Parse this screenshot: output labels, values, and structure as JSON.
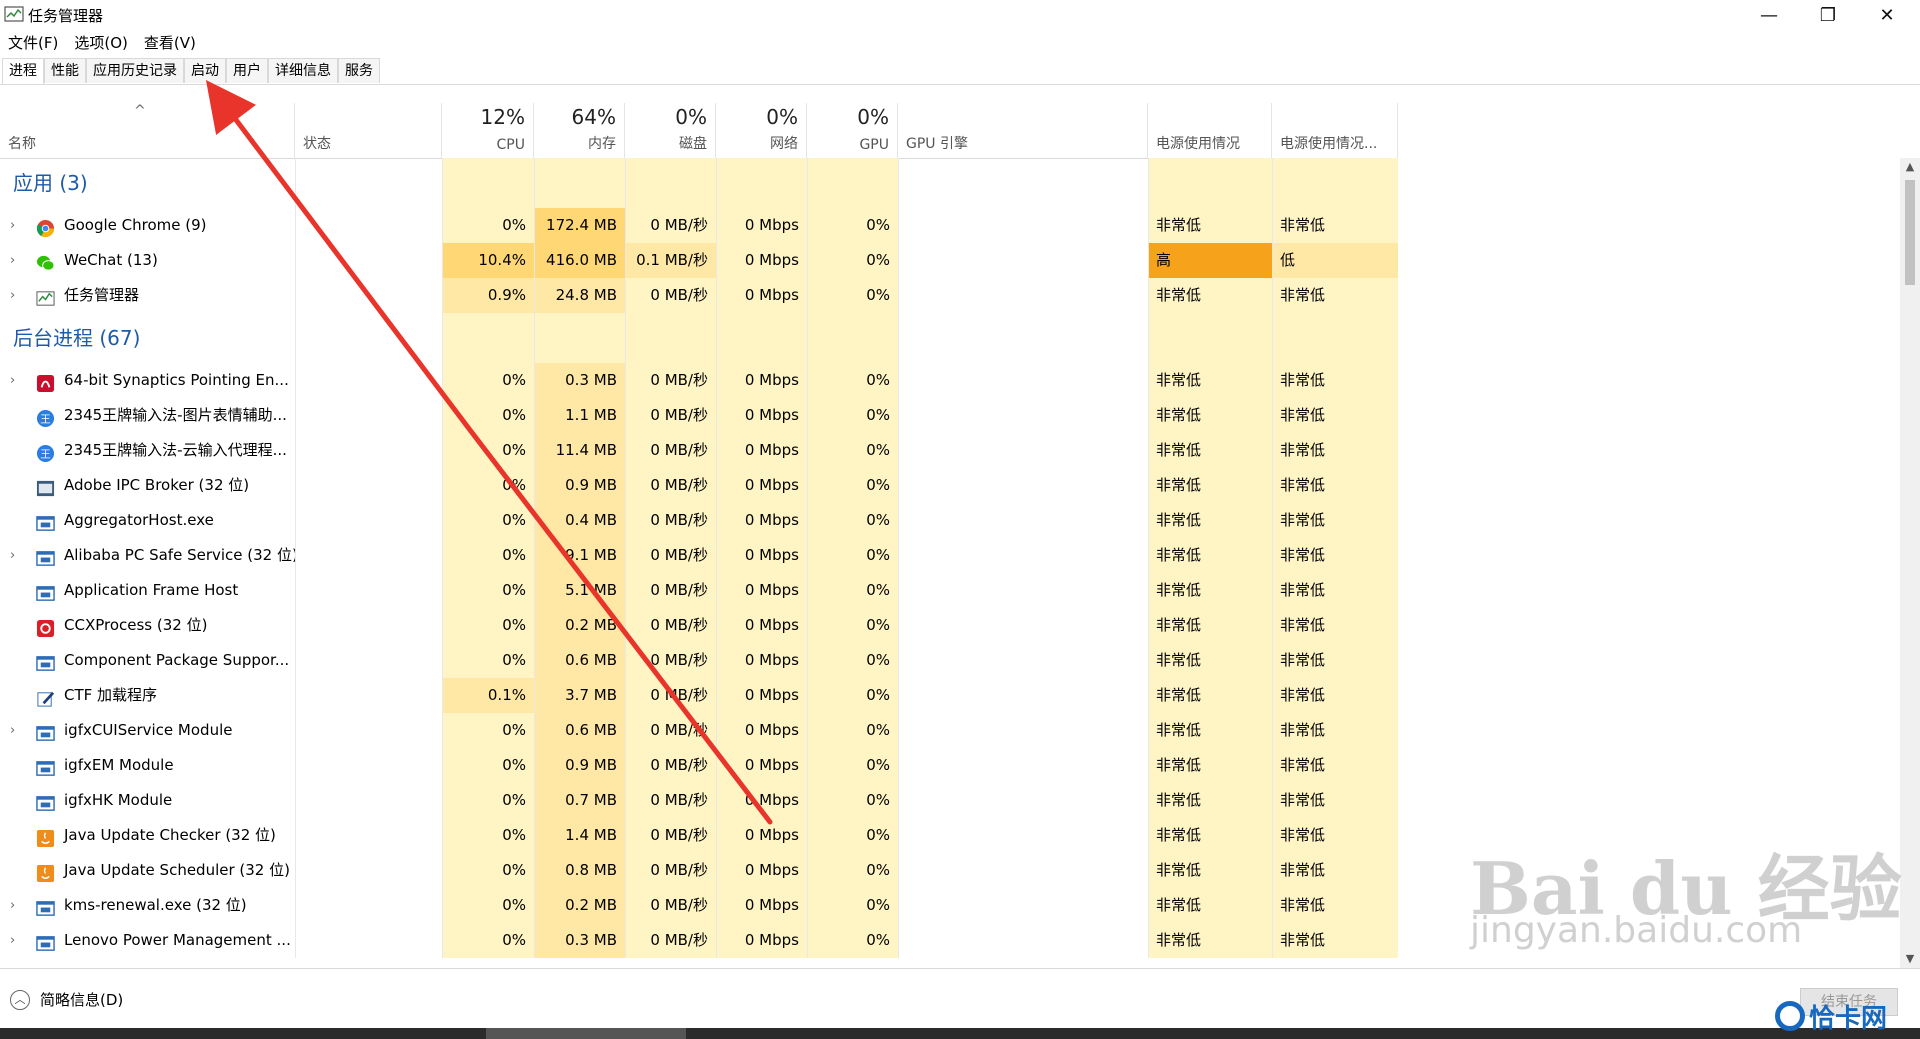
{
  "window": {
    "title": "任务管理器",
    "minimize_glyph": "—",
    "maximize_glyph": "❐",
    "close_glyph": "✕"
  },
  "menu": [
    "文件(F)",
    "选项(O)",
    "查看(V)"
  ],
  "tabs": [
    {
      "label": "进程",
      "active": true
    },
    {
      "label": "性能"
    },
    {
      "label": "应用历史记录"
    },
    {
      "label": "启动"
    },
    {
      "label": "用户"
    },
    {
      "label": "详细信息"
    },
    {
      "label": "服务"
    }
  ],
  "header": {
    "sort_glyph": "^",
    "name": "名称",
    "status": "状态",
    "cpu": {
      "pct": "12%",
      "label": "CPU"
    },
    "memory": {
      "pct": "64%",
      "label": "内存"
    },
    "disk": {
      "pct": "0%",
      "label": "磁盘"
    },
    "network": {
      "pct": "0%",
      "label": "网络"
    },
    "gpu": {
      "pct": "0%",
      "label": "GPU"
    },
    "gpu_engine": "GPU 引擎",
    "power": "电源使用情况",
    "power_trend": "电源使用情况..."
  },
  "groups": {
    "apps": "应用 (3)",
    "background": "后台进程 (67)"
  },
  "apps": [
    {
      "name": "Google Chrome (9)",
      "icon": "chrome-icon",
      "expand": true,
      "cpu": "0%",
      "mem": "172.4 MB",
      "disk": "0 MB/秒",
      "net": "0 Mbps",
      "gpu": "0%",
      "power": "非常低",
      "power_trend": "非常低"
    },
    {
      "name": "WeChat (13)",
      "icon": "wechat-icon",
      "expand": true,
      "cpu": "10.4%",
      "mem": "416.0 MB",
      "disk": "0.1 MB/秒",
      "net": "0 Mbps",
      "gpu": "0%",
      "power": "高",
      "power_trend": "低"
    },
    {
      "name": "任务管理器",
      "icon": "task-manager-icon",
      "expand": true,
      "cpu": "0.9%",
      "mem": "24.8 MB",
      "disk": "0 MB/秒",
      "net": "0 Mbps",
      "gpu": "0%",
      "power": "非常低",
      "power_trend": "非常低"
    }
  ],
  "background": [
    {
      "name": "64-bit Synaptics Pointing En...",
      "icon": "synaptics-icon",
      "expand": true,
      "cpu": "0%",
      "mem": "0.3 MB",
      "disk": "0 MB/秒",
      "net": "0 Mbps",
      "gpu": "0%",
      "power": "非常低",
      "power_trend": "非常低"
    },
    {
      "name": "2345王牌输入法-图片表情辅助...",
      "icon": "ime-icon",
      "expand": false,
      "cpu": "0%",
      "mem": "1.1 MB",
      "disk": "0 MB/秒",
      "net": "0 Mbps",
      "gpu": "0%",
      "power": "非常低",
      "power_trend": "非常低"
    },
    {
      "name": "2345王牌输入法-云输入代理程...",
      "icon": "ime-icon",
      "expand": false,
      "cpu": "0%",
      "mem": "11.4 MB",
      "disk": "0 MB/秒",
      "net": "0 Mbps",
      "gpu": "0%",
      "power": "非常低",
      "power_trend": "非常低"
    },
    {
      "name": "Adobe IPC Broker (32 位)",
      "icon": "adobe-ipc-icon",
      "expand": false,
      "cpu": "0%",
      "mem": "0.9 MB",
      "disk": "0 MB/秒",
      "net": "0 Mbps",
      "gpu": "0%",
      "power": "非常低",
      "power_trend": "非常低"
    },
    {
      "name": "AggregatorHost.exe",
      "icon": "app-window-icon",
      "expand": false,
      "cpu": "0%",
      "mem": "0.4 MB",
      "disk": "0 MB/秒",
      "net": "0 Mbps",
      "gpu": "0%",
      "power": "非常低",
      "power_trend": "非常低"
    },
    {
      "name": "Alibaba PC Safe Service (32 位)",
      "icon": "app-window-icon",
      "expand": true,
      "cpu": "0%",
      "mem": "9.1 MB",
      "disk": "0 MB/秒",
      "net": "0 Mbps",
      "gpu": "0%",
      "power": "非常低",
      "power_trend": "非常低"
    },
    {
      "name": "Application Frame Host",
      "icon": "app-window-icon",
      "expand": false,
      "cpu": "0%",
      "mem": "5.1 MB",
      "disk": "0 MB/秒",
      "net": "0 Mbps",
      "gpu": "0%",
      "power": "非常低",
      "power_trend": "非常低"
    },
    {
      "name": "CCXProcess (32 位)",
      "icon": "adobe-cc-icon",
      "expand": false,
      "cpu": "0%",
      "mem": "0.2 MB",
      "disk": "0 MB/秒",
      "net": "0 Mbps",
      "gpu": "0%",
      "power": "非常低",
      "power_trend": "非常低"
    },
    {
      "name": "Component Package Suppor...",
      "icon": "app-window-icon",
      "expand": false,
      "cpu": "0%",
      "mem": "0.6 MB",
      "disk": "0 MB/秒",
      "net": "0 Mbps",
      "gpu": "0%",
      "power": "非常低",
      "power_trend": "非常低"
    },
    {
      "name": "CTF 加载程序",
      "icon": "ctf-pen-icon",
      "expand": false,
      "cpu": "0.1%",
      "mem": "3.7 MB",
      "disk": "0 MB/秒",
      "net": "0 Mbps",
      "gpu": "0%",
      "power": "非常低",
      "power_trend": "非常低"
    },
    {
      "name": "igfxCUIService Module",
      "icon": "app-window-icon",
      "expand": true,
      "cpu": "0%",
      "mem": "0.6 MB",
      "disk": "0 MB/秒",
      "net": "0 Mbps",
      "gpu": "0%",
      "power": "非常低",
      "power_trend": "非常低"
    },
    {
      "name": "igfxEM Module",
      "icon": "app-window-icon",
      "expand": false,
      "cpu": "0%",
      "mem": "0.9 MB",
      "disk": "0 MB/秒",
      "net": "0 Mbps",
      "gpu": "0%",
      "power": "非常低",
      "power_trend": "非常低"
    },
    {
      "name": "igfxHK Module",
      "icon": "app-window-icon",
      "expand": false,
      "cpu": "0%",
      "mem": "0.7 MB",
      "disk": "0 MB/秒",
      "net": "0 Mbps",
      "gpu": "0%",
      "power": "非常低",
      "power_trend": "非常低"
    },
    {
      "name": "Java Update Checker (32 位)",
      "icon": "java-icon",
      "expand": false,
      "cpu": "0%",
      "mem": "1.4 MB",
      "disk": "0 MB/秒",
      "net": "0 Mbps",
      "gpu": "0%",
      "power": "非常低",
      "power_trend": "非常低"
    },
    {
      "name": "Java Update Scheduler (32 位)",
      "icon": "java-icon",
      "expand": false,
      "cpu": "0%",
      "mem": "0.8 MB",
      "disk": "0 MB/秒",
      "net": "0 Mbps",
      "gpu": "0%",
      "power": "非常低",
      "power_trend": "非常低"
    },
    {
      "name": "kms-renewal.exe (32 位)",
      "icon": "app-window-icon",
      "expand": true,
      "cpu": "0%",
      "mem": "0.2 MB",
      "disk": "0 MB/秒",
      "net": "0 Mbps",
      "gpu": "0%",
      "power": "非常低",
      "power_trend": "非常低"
    },
    {
      "name": "Lenovo Power Management ...",
      "icon": "app-window-icon",
      "expand": true,
      "cpu": "0%",
      "mem": "0.3 MB",
      "disk": "0 MB/秒",
      "net": "0 Mbps",
      "gpu": "0%",
      "power": "非常低",
      "power_trend": "非常低"
    }
  ],
  "footer": {
    "fewer_details": "简略信息(D)",
    "end_task": "结束任务"
  },
  "watermark": {
    "big": "Bai du 经验",
    "small": "jingyan.baidu.com"
  },
  "logo": {
    "text": "恰卡网"
  },
  "colors": {
    "accent": "#1f5aa8",
    "heat_low": "#fff4c4",
    "heat_mid": "#ffe8a6",
    "heat_high": "#ffd875",
    "power_high": "#f7a21b",
    "annotation": "#e8342a"
  }
}
